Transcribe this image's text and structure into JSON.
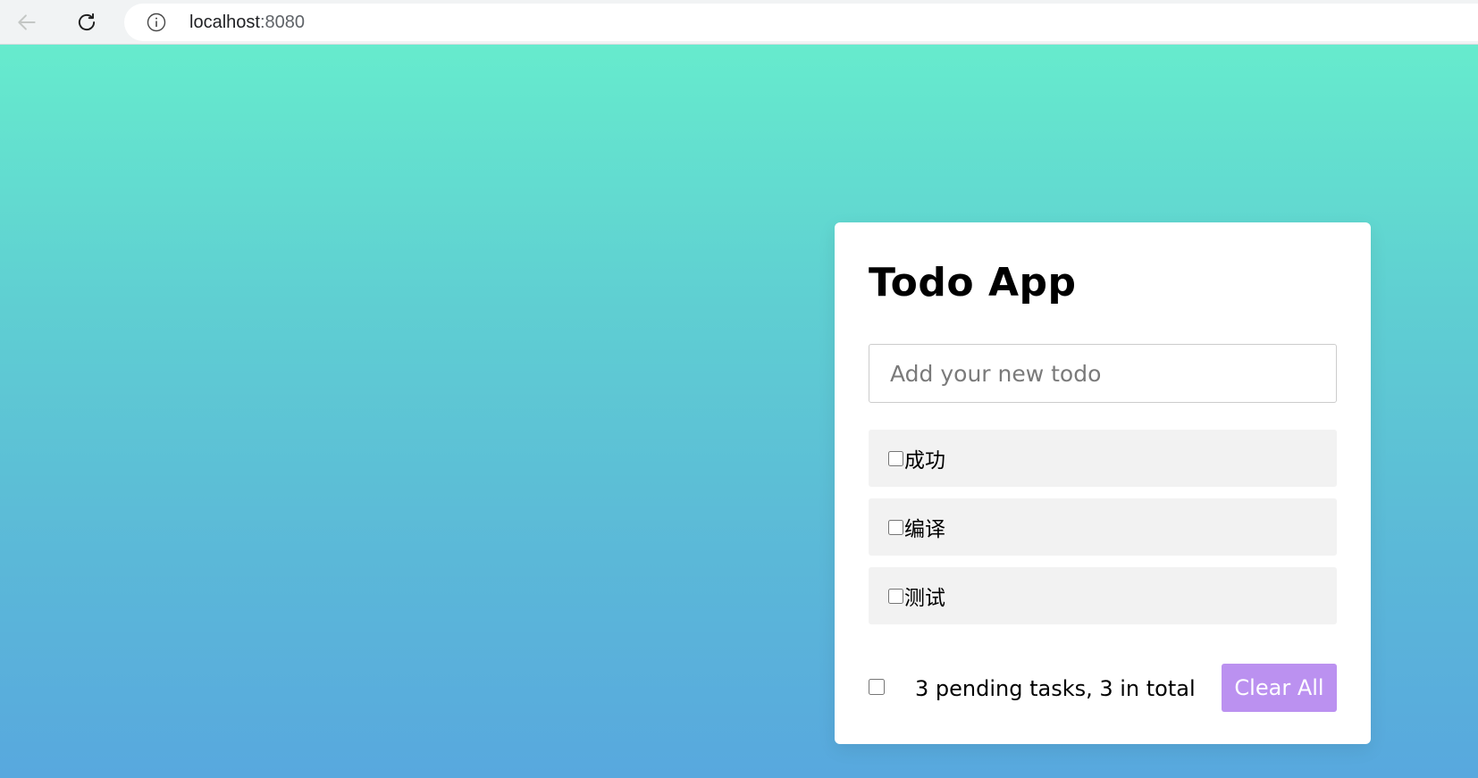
{
  "browser": {
    "url_host": "localhost",
    "url_port": ":8080",
    "icons": {
      "back": "arrow-left-icon",
      "reload": "reload-icon",
      "info": "info-icon"
    }
  },
  "app": {
    "title": "Todo App",
    "input": {
      "placeholder": "Add your new todo",
      "value": ""
    },
    "todos": [
      {
        "label": "成功",
        "checked": false
      },
      {
        "label": "编译",
        "checked": false
      },
      {
        "label": "测试",
        "checked": false
      }
    ],
    "footer": {
      "status": "3 pending tasks, 3 in total",
      "clear_label": "Clear All",
      "select_all_checked": false
    }
  },
  "colors": {
    "gradient_top": "#66ebcd",
    "gradient_bottom": "#58a8de",
    "card_bg": "#ffffff",
    "item_bg": "#f2f2f2",
    "button_bg": "#bb91f0",
    "button_text": "#ffffff"
  }
}
